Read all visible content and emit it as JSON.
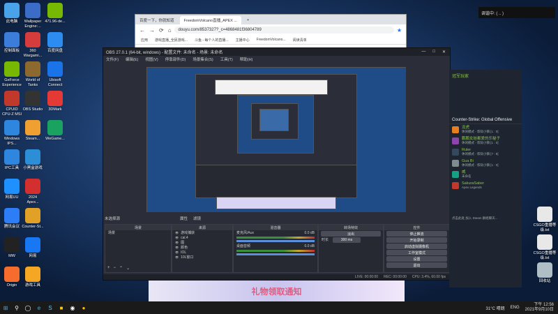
{
  "desktop": {
    "icons_left": [
      {
        "label": "此电脑",
        "icon": "computer-icon",
        "color": "#4aa3e8"
      },
      {
        "label": "控制面板",
        "icon": "control-panel-icon",
        "color": "#3c7dd9"
      },
      {
        "label": "GeForce\nExperience",
        "icon": "nvidia-icon",
        "color": "#76b900"
      },
      {
        "label": "CPUID\nCPU-Z MSI",
        "icon": "cpuz-icon",
        "color": "#c0392b"
      },
      {
        "label": "Windows\nIPS...",
        "icon": "tool-icon",
        "color": "#2e86de"
      },
      {
        "label": "IPC工具",
        "icon": "ipc-icon",
        "color": "#2e86de"
      },
      {
        "label": "网易UU",
        "icon": "uu-icon",
        "color": "#1e90ff"
      },
      {
        "label": "腾讯会议",
        "icon": "meeting-icon",
        "color": "#2d7df6"
      },
      {
        "label": "MW",
        "icon": "mw-icon",
        "color": "#222222"
      },
      {
        "label": "Origin",
        "icon": "origin-icon",
        "color": "#f56c2d"
      }
    ],
    "icons_col2": [
      {
        "label": "Wallpaper\nEngine:...",
        "icon": "wallpaper-engine-icon",
        "color": "#3b6cc7"
      },
      {
        "label": "360\nWargami...",
        "icon": "360-icon",
        "color": "#d63c3c"
      },
      {
        "label": "World of\nTanks",
        "icon": "tanks-icon",
        "color": "#8c6a2f"
      },
      {
        "label": "OBS Studio",
        "icon": "obs-icon",
        "color": "#333333"
      },
      {
        "label": "Steam...",
        "icon": "steam-icon",
        "color": "#f0a030"
      },
      {
        "label": "小黑盒游戏",
        "icon": "heybox-icon",
        "color": "#2c8ed6"
      },
      {
        "label": "2024\nApex...",
        "icon": "apex-icon",
        "color": "#d32f2f"
      },
      {
        "label": "Counter-St...",
        "icon": "csgo-icon",
        "color": "#e1a126"
      },
      {
        "label": "网易",
        "icon": "netease-icon",
        "color": "#1877f2"
      },
      {
        "label": "游戏工具",
        "icon": "tool2-icon",
        "color": "#f5a623"
      }
    ],
    "icons_col3": [
      {
        "label": "471.96-de...",
        "icon": "driver-icon",
        "color": "#76b900"
      },
      {
        "label": "百度网盘",
        "icon": "baidu-icon",
        "color": "#2d8cf0"
      },
      {
        "label": "Ubisoft\nConnect",
        "icon": "ubisoft-icon",
        "color": "#1a73e8"
      },
      {
        "label": "3DMark",
        "icon": "3dmark-icon",
        "color": "#e53935"
      },
      {
        "label": "WeGame...",
        "icon": "wegame-icon",
        "color": "#1aa260"
      }
    ],
    "icons_right": [
      {
        "label": "CSGO重播等级.txt",
        "icon": "text-file-icon",
        "color": "#e8e8e8"
      },
      {
        "label": "CSGO重播等级.txt",
        "icon": "text-file-icon",
        "color": "#e8e8e8"
      },
      {
        "label": "回收站",
        "icon": "recycle-bin-icon",
        "color": "#b0bec5"
      }
    ]
  },
  "browser": {
    "tabs": [
      "百度一下，你就知道",
      "FreedomVolcano直播_APEX ..."
    ],
    "url": "douyu.com/8537327?_c=4868481f36804789",
    "bookmarks": [
      "应用",
      "游戏直播_全民游戏...",
      "斗鱼 - 每个人的直播...",
      "主播中心",
      "FreedomVolcano...",
      "阅读清单"
    ]
  },
  "obs": {
    "title": "OBS 27.0.1 (64-bit, windows) - 配置文件: 未命名 - 场景: 未命名",
    "menu": [
      "文件(F)",
      "编辑(E)",
      "视图(V)",
      "停靠部件(D)",
      "场景集合(S)",
      "工具(T)",
      "帮助(H)"
    ],
    "scene_label": "未选择源",
    "tabs": [
      "属性",
      "滤镜"
    ],
    "docks": {
      "scenes": {
        "header": "场景",
        "items": [
          "场景"
        ]
      },
      "sources": {
        "header": "来源",
        "items": [
          "游戏捕获",
          "cal.4",
          "图",
          "颜色",
          "IOL",
          "10L窗口"
        ]
      },
      "mixer": {
        "header": "混音器",
        "channels": [
          {
            "name": "麦克风/Aux",
            "db": "0.0 dB"
          },
          {
            "name": "桌面音频",
            "db": "0.0 dB"
          }
        ]
      },
      "transitions": {
        "header": "转场特效",
        "type": "淡出",
        "duration_label": "时长",
        "duration": "300 ms"
      },
      "controls": {
        "header": "控件",
        "buttons": [
          "停止推流",
          "开始录制",
          "启动虚拟摄像机",
          "工作室模式",
          "设置",
          "退出"
        ]
      }
    },
    "status": {
      "live": "LIVE: 00:00:00",
      "rec": "REC: 00:00:00",
      "cpu": "CPU: 3.4%, 60.00 fps"
    }
  },
  "steam_panel": {
    "header": "冠军玩家",
    "game_title": "Counter-Strike: Global Offensive",
    "friends": [
      {
        "name": "龙虎",
        "status": "休闲模式 - 炼狱小镇 [1 : 0]",
        "color": "#e67e22"
      },
      {
        "name": "鹏鹏女娃都爱的乐秘子",
        "status": "休闲模式 - 炼狱小镇 [1 : 0]",
        "color": "#8e44ad"
      },
      {
        "name": "Ruler",
        "status": "休闲模式 - 炼狱小镇 [7 : 8]",
        "color": "#34495e"
      },
      {
        "name": "Gua Bi",
        "status": "休闲模式 - 炼狱小镇 [1 : 0]",
        "color": "#7f8c8d"
      },
      {
        "name": "威",
        "status": "未命名",
        "color": "#16a085"
      },
      {
        "name": "SakuraSaber",
        "status": "Apex Legends",
        "color": "#c0392b"
      }
    ],
    "footer": "点击此处 加入 Steam 群组聊天..."
  },
  "notification": {
    "text": "调谐中: (   ..  )"
  },
  "banner": {
    "text": "礼物领取通知"
  },
  "taskbar": {
    "weather": "31°C 晴朗",
    "lang": "ENG",
    "time": "下午 12:56",
    "date": "2021年9月10日"
  }
}
